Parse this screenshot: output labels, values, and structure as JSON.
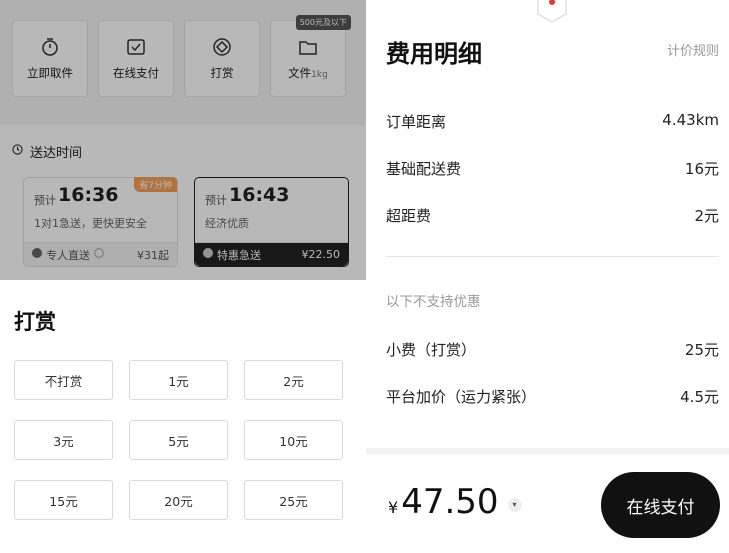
{
  "services": [
    {
      "label": "立即取件",
      "icon": "timer-icon"
    },
    {
      "label": "在线支付",
      "icon": "payment-icon"
    },
    {
      "label": "打赏",
      "icon": "tip-icon"
    },
    {
      "label": "文件",
      "suffix": "1kg",
      "icon": "folder-icon",
      "badge": "500元及以下"
    }
  ],
  "delivery": {
    "title": "送达时间",
    "options": [
      {
        "prefix": "预计",
        "time": "16:36",
        "tag": "省7分钟",
        "desc": "1对1急送，更快更安全",
        "mode": "专人直送",
        "price": "¥31起"
      },
      {
        "prefix": "预计",
        "time": "16:43",
        "desc": "经济优质",
        "mode": "特惠急送",
        "price": "¥22.50"
      }
    ]
  },
  "tip_sheet": {
    "title": "打赏",
    "options": [
      "不打赏",
      "1元",
      "2元",
      "3元",
      "5元",
      "10元",
      "15元",
      "20元",
      "25元"
    ]
  },
  "fee_detail": {
    "title": "费用明细",
    "rule_link": "计价规则",
    "rows": [
      {
        "label": "订单距离",
        "value": "4.43km"
      },
      {
        "label": "基础配送费",
        "value": "16元"
      },
      {
        "label": "超距费",
        "value": "2元"
      }
    ],
    "section_label": "以下不支持优惠",
    "extra_rows": [
      {
        "label": "小费（打赏）",
        "value": "25元"
      },
      {
        "label": "平台加价（运力紧张）",
        "value": "4.5元"
      }
    ],
    "currency": "¥",
    "total": "47.50",
    "pay_button": "在线支付"
  },
  "colors": {
    "accent": "#111111",
    "tag": "#f3a05b",
    "logo": "#e53935"
  }
}
